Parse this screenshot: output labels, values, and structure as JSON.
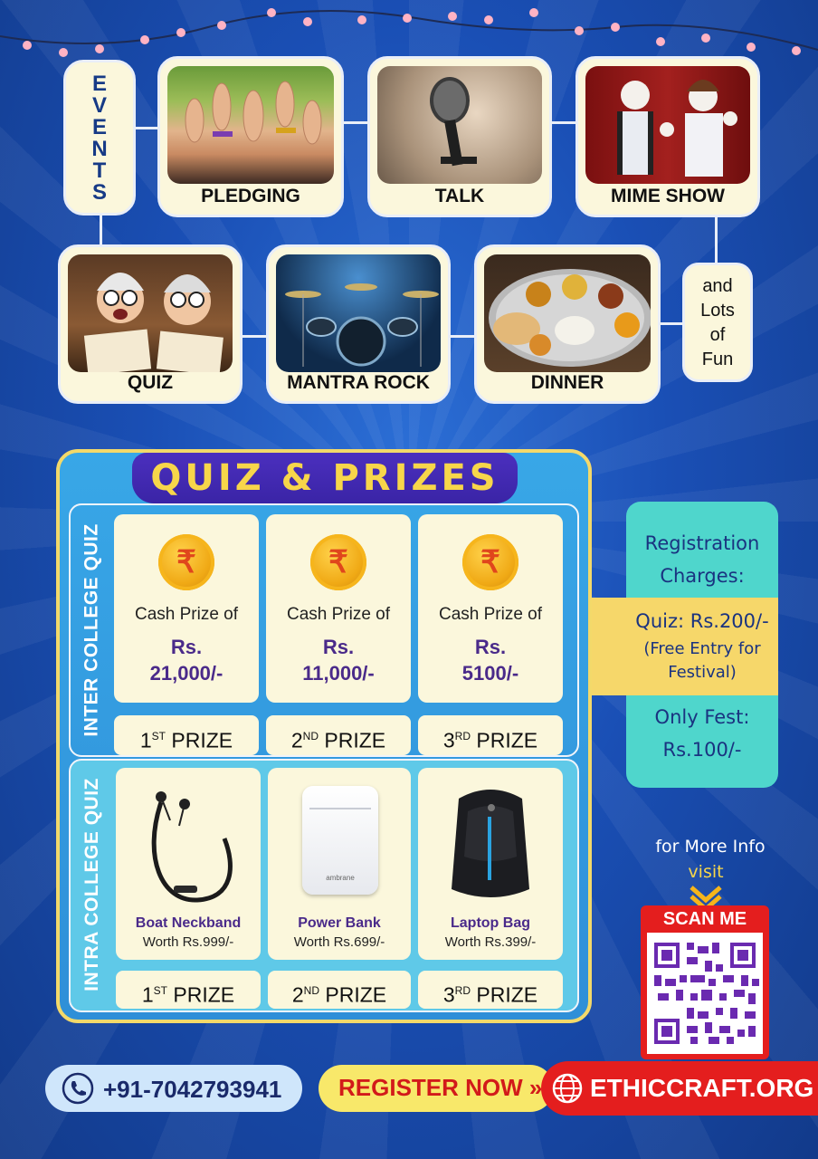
{
  "events": {
    "heading": [
      "E",
      "V",
      "E",
      "N",
      "T",
      "S"
    ],
    "items": [
      {
        "label": "PLEDGING",
        "icon": "raised-hands-photo"
      },
      {
        "label": "TALK",
        "icon": "microphone-photo"
      },
      {
        "label": "MIME SHOW",
        "icon": "mime-performers-photo"
      },
      {
        "label": "QUIZ",
        "icon": "quiz-cartoon-photo"
      },
      {
        "label": "MANTRA ROCK",
        "icon": "drum-kit-photo"
      },
      {
        "label": "DINNER",
        "icon": "thali-photo"
      }
    ],
    "more": [
      "and",
      "Lots",
      "of",
      "Fun"
    ]
  },
  "quiz": {
    "title": "QUIZ & PRIZES",
    "inter": {
      "label": "INTER COLLEGE QUIZ",
      "cash_prefix": "Cash Prize of",
      "prizes": [
        {
          "currency": "Rs.",
          "amount": "21,000/-",
          "rank_num": "1",
          "rank_sup": "ST",
          "rank_word": "PRIZE"
        },
        {
          "currency": "Rs.",
          "amount": "11,000/-",
          "rank_num": "2",
          "rank_sup": "ND",
          "rank_word": "PRIZE"
        },
        {
          "currency": "Rs.",
          "amount": "5100/-",
          "rank_num": "3",
          "rank_sup": "RD",
          "rank_word": "PRIZE"
        }
      ],
      "coin_symbol": "₹"
    },
    "intra": {
      "label": "INTRA COLLEGE QUIZ",
      "prizes": [
        {
          "name": "Boat Neckband",
          "worth": "Worth Rs.999/-",
          "rank_num": "1",
          "rank_sup": "ST",
          "rank_word": "PRIZE"
        },
        {
          "name": "Power Bank",
          "worth": "Worth Rs.699/-",
          "rank_num": "2",
          "rank_sup": "ND",
          "rank_word": "PRIZE"
        },
        {
          "name": "Laptop Bag",
          "worth": "Worth Rs.399/-",
          "rank_num": "3",
          "rank_sup": "RD",
          "rank_word": "PRIZE"
        }
      ],
      "powerbank_brand": "ambrane"
    }
  },
  "registration": {
    "title_line1": "Registration",
    "title_line2": "Charges:",
    "quiz_line": "Quiz: Rs.200/-",
    "free_line1": "(Free Entry for",
    "free_line2": "Festival)",
    "fest_line1": "Only Fest:",
    "fest_line2": "Rs.100/-"
  },
  "info": {
    "line1": "for More Info",
    "line2": "visit",
    "scan": "SCAN ME"
  },
  "footer": {
    "phone": "+91-7042793941",
    "register": "REGISTER NOW",
    "register_arrows": "»",
    "website": "ETHICCRAFT.ORG"
  },
  "colors": {
    "background": "#1a4fb5",
    "card": "#fbf7dc",
    "accent_yellow": "#f7d64a",
    "accent_purple": "#4a2a8a",
    "teal": "#4fd6cc",
    "red": "#e41e1e"
  }
}
